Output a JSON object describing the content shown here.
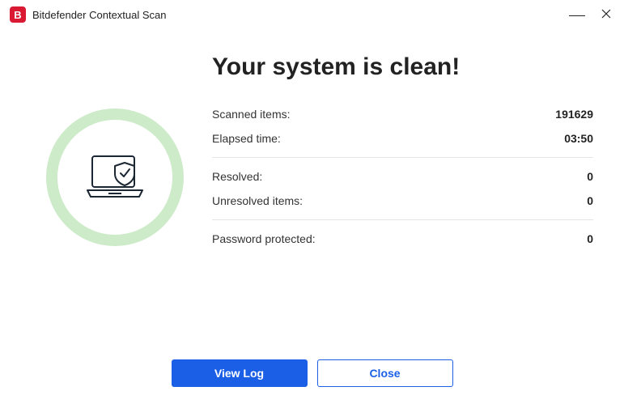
{
  "titlebar": {
    "app_letter": "B",
    "title": "Bitdefender Contextual Scan"
  },
  "main": {
    "headline": "Your system is clean!",
    "stats": {
      "scanned_label": "Scanned items:",
      "scanned_value": "191629",
      "elapsed_label": "Elapsed time:",
      "elapsed_value": "03:50",
      "resolved_label": "Resolved:",
      "resolved_value": "0",
      "unresolved_label": "Unresolved items:",
      "unresolved_value": "0",
      "password_label": "Password protected:",
      "password_value": "0"
    }
  },
  "buttons": {
    "view_log": "View Log",
    "close": "Close"
  }
}
